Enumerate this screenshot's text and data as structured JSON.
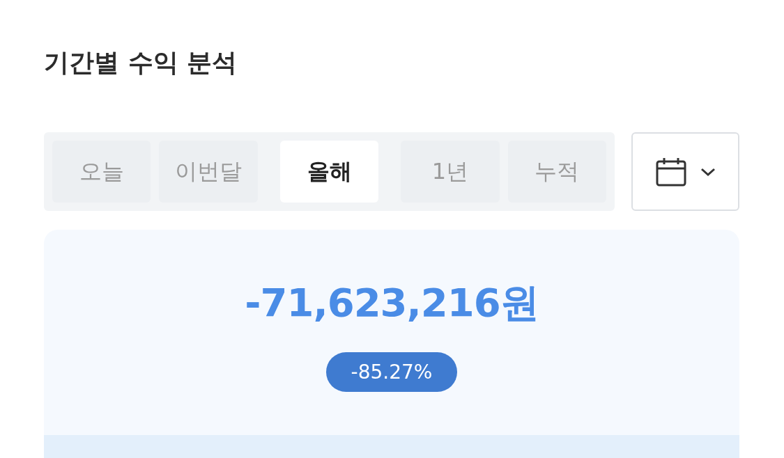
{
  "title": "기간별 수익 분석",
  "tabs": [
    {
      "label": "오늘",
      "selected": false
    },
    {
      "label": "이번달",
      "selected": false
    },
    {
      "label": "올해",
      "selected": true
    },
    {
      "label": "1년",
      "selected": false
    },
    {
      "label": "누적",
      "selected": false
    }
  ],
  "summary": {
    "amount": "-71,623,216원",
    "rate": "-85.27%"
  }
}
